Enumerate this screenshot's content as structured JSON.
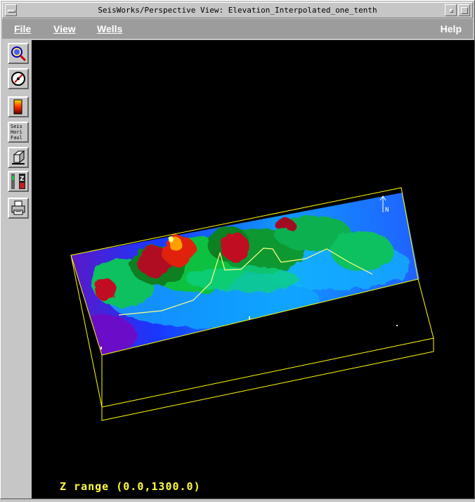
{
  "window": {
    "title": "SeisWorks/Perspective View: Elevation_Interpolated_one_tenth"
  },
  "menubar": {
    "left": [
      {
        "label": "File"
      },
      {
        "label": "View"
      },
      {
        "label": "Wells"
      }
    ],
    "help": "Help"
  },
  "toolbar": {
    "tools": [
      {
        "name": "zoom-tool",
        "icon": "magnifier-icon"
      },
      {
        "name": "rotate-tool",
        "icon": "compass-dial-icon"
      },
      {
        "name": "colorbar-tool",
        "icon": "color-scale-icon"
      },
      {
        "name": "display-objects-tool",
        "icon": "checklist-icon",
        "lines": [
          "Seis",
          "Hori",
          "Faul"
        ]
      },
      {
        "name": "box-view-tool",
        "icon": "cube-icon"
      },
      {
        "name": "z-scale-tool",
        "icon": "z-scale-icon",
        "letter": "Z"
      },
      {
        "name": "print-tool",
        "icon": "printer-icon"
      }
    ]
  },
  "viewport": {
    "z_range_label": "Z range (0.0,1300.0)",
    "bounding_box_color": "#ffff00",
    "north_arrow": "N",
    "colormap": [
      "#6a10c8",
      "#1030ff",
      "#10a0ff",
      "#10d060",
      "#108020",
      "#a01020",
      "#ff2010",
      "#ffc000",
      "#ffffa0"
    ]
  }
}
